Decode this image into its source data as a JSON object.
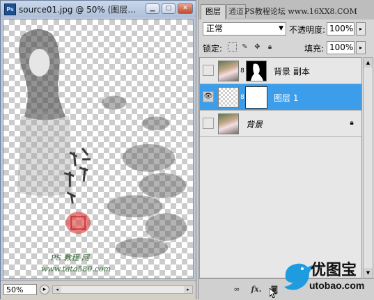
{
  "document": {
    "app_icon": "Ps",
    "title": "source01.jpg @ 50% (图层…",
    "window_buttons": [
      "minimize-icon",
      "maximize-icon",
      "close-icon"
    ],
    "canvas": {
      "watermark_line1": "PS 教程 网",
      "watermark_line2": "www.tata580.com",
      "calligraphy": "他如我帮你"
    },
    "status": {
      "zoom": "50%"
    }
  },
  "layers_panel": {
    "tabs": [
      {
        "label": "图层",
        "active": true
      },
      {
        "label": "通道",
        "active": false
      }
    ],
    "site_banner": "PS教程论坛  www.16XX8.COM",
    "blend_mode": "正常",
    "opacity_label": "不透明度:",
    "opacity_value": "100%",
    "lock_label": "锁定:",
    "lock_icons": [
      "lock-transparent-icon",
      "lock-paint-icon",
      "lock-move-icon",
      "lock-all-icon"
    ],
    "fill_label": "填充:",
    "fill_value": "100%",
    "layers": [
      {
        "name": "背景 副本",
        "visible": false,
        "selected": false,
        "has_mask": true,
        "mask": "black-figure"
      },
      {
        "name": "图层 1",
        "visible": true,
        "selected": true,
        "has_mask": true,
        "mask": "white"
      },
      {
        "name": "背景",
        "visible": false,
        "selected": false,
        "has_mask": false,
        "locked": true
      }
    ],
    "footer_icons": [
      "link-icon",
      "fx-icon",
      "mask-icon"
    ]
  },
  "overlay_logo": {
    "brand_cn": "优图宝",
    "brand_en": "utobao.com",
    "accent_color": "#1f9be0"
  }
}
